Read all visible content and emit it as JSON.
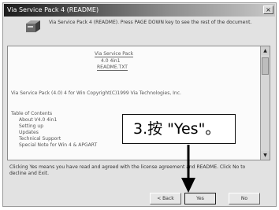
{
  "window": {
    "title": "Via Service Pack 4 (README)",
    "close_glyph": "×"
  },
  "header": {
    "icon": "software-box-icon",
    "text": "Via Service Pack 4 (README). Press PAGE DOWN key to see the rest of the document."
  },
  "document": {
    "lines": [
      {
        "text": "Via Service Pack",
        "style": "center"
      },
      {
        "text": "4.0  4in1",
        "style": "center"
      },
      {
        "text": "README.TXT",
        "style": "center"
      },
      {
        "text": "Via Service Pack (4.0) 4 for Win Copyright(C)1999 Via Technologies, Inc.",
        "style": "left"
      },
      {
        "text": "Table of Contents",
        "style": "left"
      },
      {
        "text": "About V4.0 4in1",
        "style": "indent"
      },
      {
        "text": "Setting up",
        "style": "indent"
      },
      {
        "text": "Updates",
        "style": "indent"
      },
      {
        "text": "Technical Support",
        "style": "indent"
      },
      {
        "text": "Special Note for Win 4 & APGART",
        "style": "indent"
      }
    ]
  },
  "agreement_text": "Clicking Yes means you have read and agreed with the license agreement and README. Click No to decline and Exit.",
  "buttons": {
    "back": "< Back",
    "yes": "Yes",
    "no": "No"
  },
  "callout": {
    "text": "3.按 \"Yes\"。"
  },
  "colors": {
    "dialog_bg": "#e2e2e2",
    "titlebar_dark": "#1c1c1c",
    "callout_border": "#111111"
  }
}
